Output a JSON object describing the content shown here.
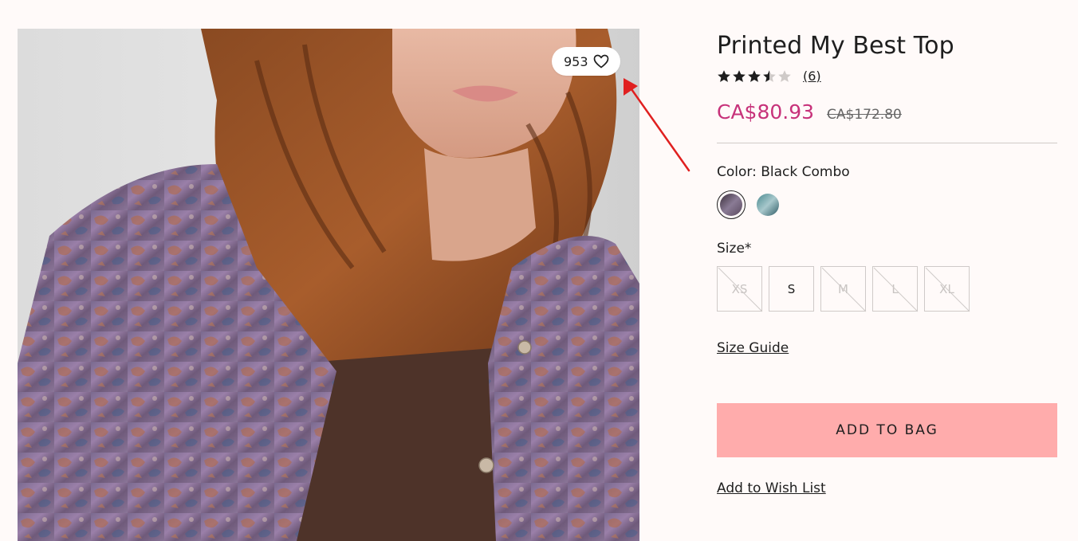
{
  "product": {
    "title": "Printed My Best Top",
    "rating": 3.5,
    "rating_max": 5,
    "review_count": "(6)",
    "sale_price": "CA$80.93",
    "original_price": "CA$172.80",
    "wishlist_count": "953"
  },
  "color": {
    "label": "Color:",
    "selected_name": "Black Combo",
    "swatches": [
      {
        "name": "black-combo",
        "selected": true,
        "colors": [
          "#3a2f3a",
          "#8a7b95",
          "#5a4a5f"
        ]
      },
      {
        "name": "blue-combo",
        "selected": false,
        "colors": [
          "#4a8a90",
          "#a8c8cc",
          "#2f5c66"
        ]
      }
    ]
  },
  "size": {
    "label": "Size*",
    "options": [
      {
        "label": "XS",
        "available": false
      },
      {
        "label": "S",
        "available": true
      },
      {
        "label": "M",
        "available": false
      },
      {
        "label": "L",
        "available": false
      },
      {
        "label": "XL",
        "available": false
      }
    ],
    "guide_label": "Size Guide"
  },
  "actions": {
    "add_to_bag": "ADD TO BAG",
    "add_to_wish_list": "Add to Wish List"
  },
  "colors": {
    "sale": "#c7327a",
    "button_bg": "#ffacac",
    "annotation": "#e02020"
  },
  "icons": {
    "wishlist": "heart-icon",
    "rating": "star-icon"
  }
}
